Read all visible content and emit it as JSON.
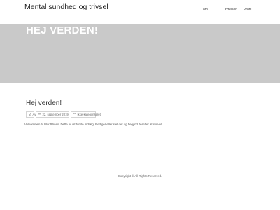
{
  "site": {
    "title": "Mental sundhed og trivsel"
  },
  "nav": {
    "items": [
      "om",
      "Ydelser",
      "Profil"
    ]
  },
  "hero": {
    "title": "HEJ VERDEN!"
  },
  "post": {
    "title": "Hej verden!",
    "author": "Av",
    "date": "22. september 2019",
    "category": "Ikke-kategoriseret",
    "excerpt": "Velkommen til WordPress. Dette er dit første indlæg. Rediger eller slet det og begynd derefter at skrive!",
    "icons": [
      "user-icon",
      "calendar-icon",
      "folder-icon"
    ]
  },
  "footer": {
    "copyright": "Copyright © All Rights Reserved."
  },
  "colors": {
    "hero_bg": "#c9c9c9",
    "hero_text": "#ffffff",
    "body_bg": "#ffffff"
  }
}
